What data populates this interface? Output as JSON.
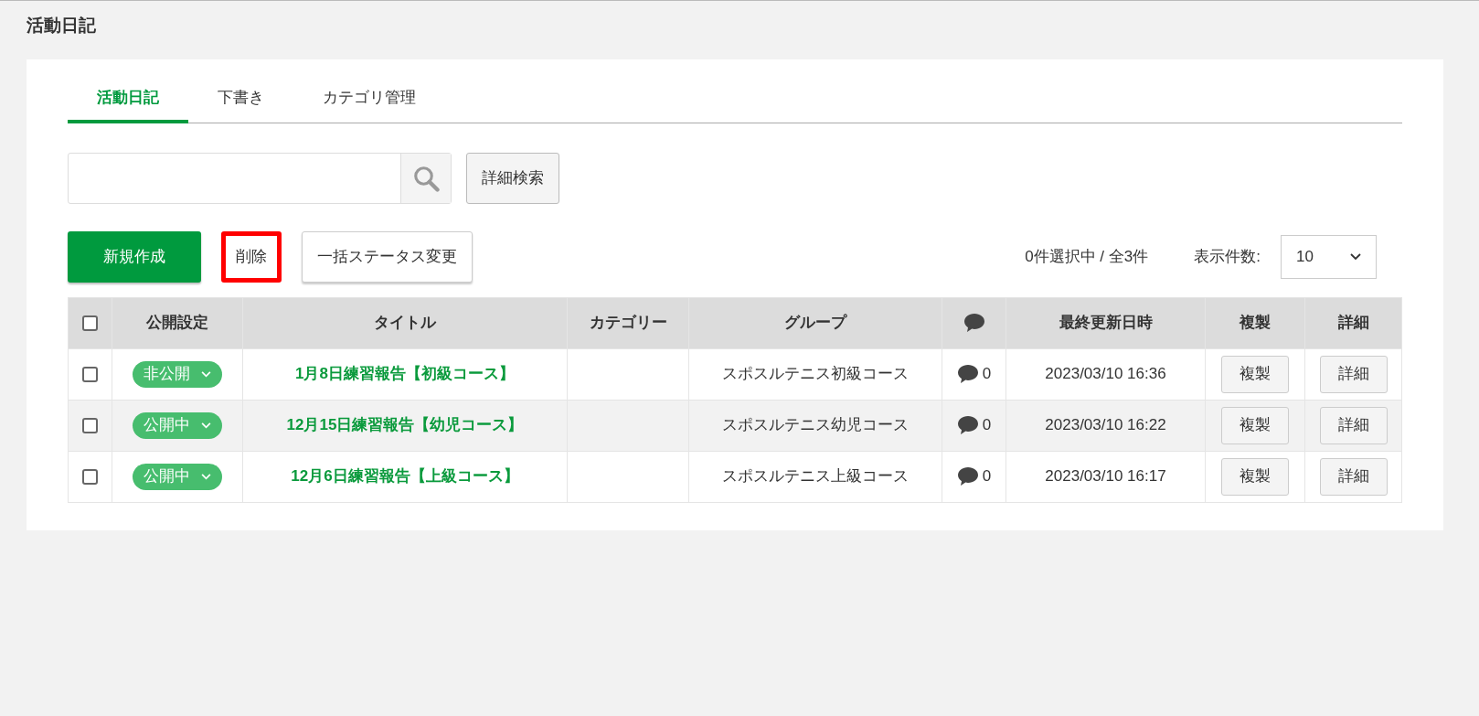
{
  "page_title": "活動日記",
  "tabs": [
    {
      "label": "活動日記",
      "selected": true
    },
    {
      "label": "下書き",
      "selected": false
    },
    {
      "label": "カテゴリ管理",
      "selected": false
    }
  ],
  "search": {
    "advanced_button": "詳細検索"
  },
  "actions": [
    {
      "label": "新規作成",
      "kind": "primary",
      "highlighted": false
    },
    {
      "label": "削除",
      "kind": "plain",
      "highlighted": true
    },
    {
      "label": "一括ステータス変更",
      "kind": "outline",
      "highlighted": false
    }
  ],
  "selection_summary": "0件選択中 / 全3件",
  "page_size": {
    "label": "表示件数:",
    "value": "10"
  },
  "table": {
    "select_all_checked": false,
    "columns": [
      {
        "label": "公開設定",
        "kind": "text"
      },
      {
        "label": "タイトル",
        "kind": "text"
      },
      {
        "label": "カテゴリー",
        "kind": "text"
      },
      {
        "label": "グループ",
        "kind": "text"
      },
      {
        "kind": "comment-icon"
      },
      {
        "label": "最終更新日時",
        "kind": "text"
      },
      {
        "label": "複製",
        "kind": "text"
      },
      {
        "label": "詳細",
        "kind": "text"
      }
    ],
    "rows": [
      {
        "checked": false,
        "status": "非公開",
        "title": "1月8日練習報告【初級コース】",
        "group": "スポスルテニス初級コース",
        "comments": "0",
        "updated": "2023/03/10 16:36",
        "copy_button": "複製",
        "detail_button": "詳細"
      },
      {
        "checked": false,
        "status": "公開中",
        "title": "12月15日練習報告【幼児コース】",
        "group": "スポスルテニス幼児コース",
        "comments": "0",
        "updated": "2023/03/10 16:22",
        "copy_button": "複製",
        "detail_button": "詳細"
      },
      {
        "checked": false,
        "status": "公開中",
        "title": "12月6日練習報告【上級コース】",
        "group": "スポスルテニス上級コース",
        "comments": "0",
        "updated": "2023/03/10 16:17",
        "copy_button": "複製",
        "detail_button": "詳細"
      }
    ]
  }
}
